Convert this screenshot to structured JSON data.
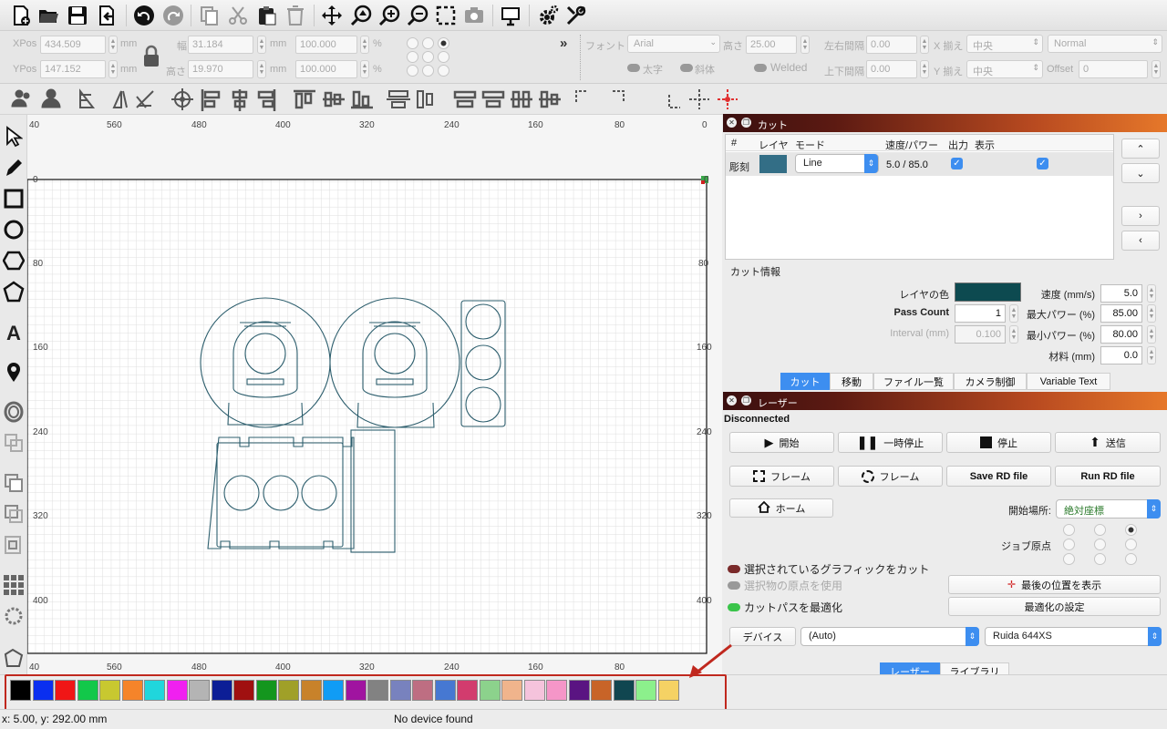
{
  "props": {
    "xpos_label": "XPos",
    "xpos": "434.509",
    "ypos_label": "YPos",
    "ypos": "147.152",
    "unit": "mm",
    "width_label": "幅",
    "width": "31.184",
    "height_label": "高さ",
    "height": "19.970",
    "scale_w": "100.000",
    "scale_h": "100.000",
    "percent": "%",
    "font_label": "フォント",
    "font_value": "Arial",
    "font_height_label": "高さ",
    "font_height": "25.00",
    "hspace_label": "左右間隔",
    "hspace": "0.00",
    "vspace_label": "上下間隔",
    "vspace": "0.00",
    "xalign_label": "X 揃え",
    "xalign": "中央",
    "yalign_label": "Y 揃え",
    "yalign": "中央",
    "style_value": "Normal",
    "offset_label": "Offset",
    "offset": "0",
    "bold": "太字",
    "italic": "斜体",
    "welded": "Welded",
    "more": "»"
  },
  "ruler": {
    "top": [
      "40",
      "560",
      "480",
      "400",
      "320",
      "240",
      "160",
      "80",
      "0"
    ],
    "left": [
      "0",
      "80",
      "160",
      "240",
      "320",
      "400"
    ],
    "right": [
      "0",
      "80",
      "160",
      "240",
      "320",
      "400"
    ]
  },
  "cut_panel": {
    "title": "カット",
    "col_no": "#",
    "col_layer": "レイヤ",
    "col_mode": "モード",
    "col_speed": "速度/パワー",
    "col_output": "出力",
    "col_show": "表示",
    "row_name": "彫刻",
    "row_mode": "Line",
    "row_speed": "5.0 / 85.0",
    "layer_color": "#336e86",
    "info_label": "カット情報",
    "layer_color_label": "レイヤの色",
    "layer_color_swatch": "#0d4a50",
    "speed_label": "速度 (mm/s)",
    "speed": "5.0",
    "pass_label": "Pass Count",
    "pass": "1",
    "maxp_label": "最大パワー (%)",
    "maxp": "85.00",
    "interval_label": "Interval (mm)",
    "interval": "0.100",
    "minp_label": "最小パワー (%)",
    "minp": "80.00",
    "material_label": "材料 (mm)",
    "material": "0.0",
    "tabs": [
      "カット",
      "移動",
      "ファイル一覧",
      "カメラ制御",
      "Variable Text"
    ]
  },
  "laser_panel": {
    "title": "レーザー",
    "status": "Disconnected",
    "start": "開始",
    "pause": "一時停止",
    "stop": "停止",
    "send": "送信",
    "frame1": "フレーム",
    "frame2": "フレーム",
    "save_rd": "Save RD file",
    "run_rd": "Run RD file",
    "home": "ホーム",
    "start_from_label": "開始場所:",
    "start_from": "絶対座標",
    "job_origin": "ジョブ原点",
    "cut_selected": "選択されているグラフィックをカット",
    "use_origin": "選択物の原点を使用",
    "optimize": "カットパスを最適化",
    "show_last": "最後の位置を表示",
    "opt_settings": "最適化の設定",
    "device_btn": "デバイス",
    "device_port": "(Auto)",
    "device_model": "Ruida 644XS",
    "tabs": [
      "レーザー",
      "ライブラリ"
    ]
  },
  "palette": [
    "#000000",
    "#0a2ff0",
    "#f01616",
    "#12c84a",
    "#c8c830",
    "#f5842a",
    "#20d6dc",
    "#f020f0",
    "#b4b4b4",
    "#0c1e96",
    "#a01010",
    "#14961e",
    "#a0a028",
    "#c8822a",
    "#109cf5",
    "#a014a0",
    "#828282",
    "#7882be",
    "#be6e82",
    "#4678d2",
    "#d23c6e",
    "#8cd28c",
    "#f0b48c",
    "#f5c3dc",
    "#f596c8",
    "#5a1482",
    "#c86428",
    "#104650",
    "#8cf08c",
    "#f5d264"
  ],
  "status": {
    "coords": "x: 5.00, y: 292.00 mm",
    "device": "No device found"
  }
}
